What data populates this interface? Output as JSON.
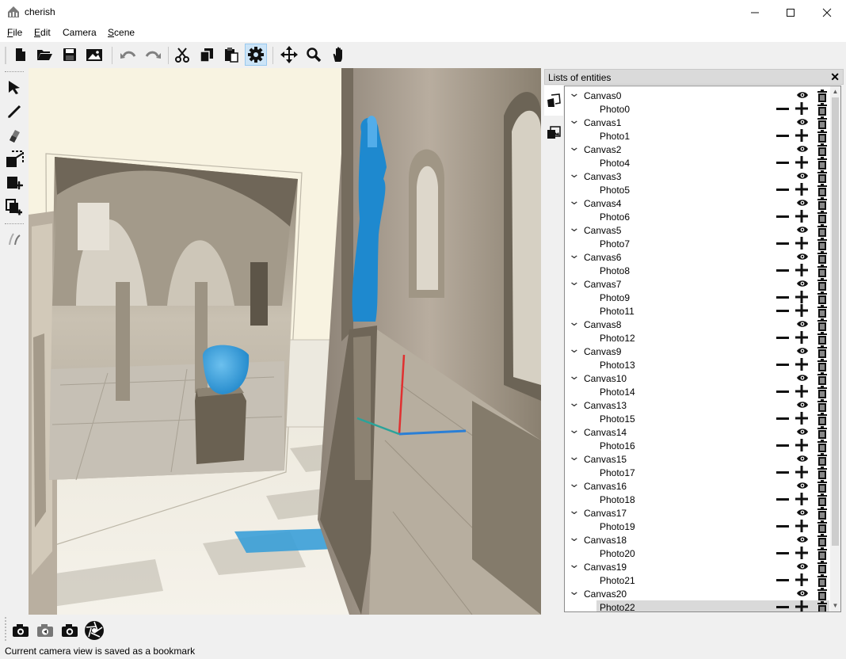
{
  "window": {
    "title": "cherish",
    "minimize_icon": "minimize-icon",
    "maximize_icon": "maximize-icon",
    "close_icon": "close-icon"
  },
  "menu": {
    "items": [
      {
        "label": "File",
        "underline": "F",
        "rest": "ile"
      },
      {
        "label": "Edit",
        "underline": "E",
        "rest": "dit"
      },
      {
        "label": "Camera",
        "underline": "",
        "rest": "Camera"
      },
      {
        "label": "Scene",
        "underline": "S",
        "rest": "cene"
      }
    ]
  },
  "toolbar": {
    "buttons": [
      "new-file-icon",
      "open-folder-icon",
      "save-icon",
      "image-icon",
      "undo-icon",
      "redo-icon",
      "cut-icon",
      "copy-icon",
      "paste-icon",
      "settings-icon",
      "move-icon",
      "zoom-icon",
      "pan-hand-icon"
    ],
    "active": "settings-icon"
  },
  "left_tools": [
    "select-arrow-icon",
    "pen-icon",
    "eraser-icon",
    "canvas-select-icon",
    "canvas-add-icon",
    "photo-clone-icon",
    "stroke-curve-icon"
  ],
  "panel": {
    "title": "Lists of entities",
    "close_label": "✕",
    "tabs": [
      "canvas-tab-icon",
      "photo-tab-icon"
    ],
    "selected_row": "Photo22",
    "tree": [
      {
        "canvas": "Canvas0",
        "photos": [
          "Photo0"
        ]
      },
      {
        "canvas": "Canvas1",
        "photos": [
          "Photo1"
        ]
      },
      {
        "canvas": "Canvas2",
        "photos": [
          "Photo4"
        ]
      },
      {
        "canvas": "Canvas3",
        "photos": [
          "Photo5"
        ]
      },
      {
        "canvas": "Canvas4",
        "photos": [
          "Photo6"
        ]
      },
      {
        "canvas": "Canvas5",
        "photos": [
          "Photo7"
        ]
      },
      {
        "canvas": "Canvas6",
        "photos": [
          "Photo8"
        ]
      },
      {
        "canvas": "Canvas7",
        "photos": [
          "Photo9",
          "Photo11"
        ]
      },
      {
        "canvas": "Canvas8",
        "photos": [
          "Photo12"
        ]
      },
      {
        "canvas": "Canvas9",
        "photos": [
          "Photo13"
        ]
      },
      {
        "canvas": "Canvas10",
        "photos": [
          "Photo14"
        ]
      },
      {
        "canvas": "Canvas13",
        "photos": [
          "Photo15"
        ]
      },
      {
        "canvas": "Canvas14",
        "photos": [
          "Photo16"
        ]
      },
      {
        "canvas": "Canvas15",
        "photos": [
          "Photo17"
        ]
      },
      {
        "canvas": "Canvas16",
        "photos": [
          "Photo18"
        ]
      },
      {
        "canvas": "Canvas17",
        "photos": [
          "Photo19"
        ]
      },
      {
        "canvas": "Canvas18",
        "photos": [
          "Photo20"
        ]
      },
      {
        "canvas": "Canvas19",
        "photos": [
          "Photo21"
        ]
      },
      {
        "canvas": "Canvas20",
        "photos": [
          "Photo22"
        ]
      }
    ]
  },
  "bottom": {
    "buttons": [
      "camera-bookmark-icon",
      "camera-previous-icon",
      "camera-next-icon",
      "aperture-icon"
    ],
    "status": "Current camera view is saved as a bookmark"
  },
  "colors": {
    "accent_active": "#cce4f7",
    "selection": "#d9d9d9",
    "viewport_background": "#f3eedc",
    "stroke_blue": "#1f8fd6",
    "axis_red": "#e03030",
    "axis_blue": "#2a7fd6",
    "axis_teal": "#2aa39a"
  }
}
